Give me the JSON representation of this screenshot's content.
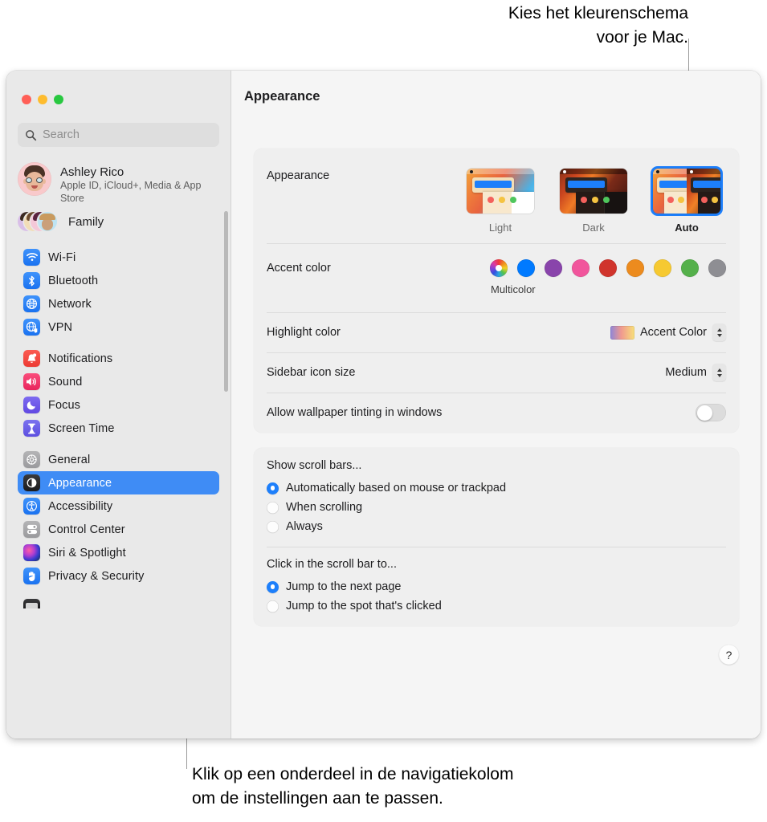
{
  "callouts": {
    "top": "Kies het kleurenschema\nvoor je Mac.",
    "bottom": "Klik op een onderdeel in de navigatiekolom\nom de instellingen aan te passen."
  },
  "window": {
    "traffic_lights": [
      "close",
      "minimize",
      "zoom"
    ]
  },
  "search": {
    "value": "",
    "placeholder": "Search"
  },
  "account": {
    "name": "Ashley Rico",
    "subtitle": "Apple ID, iCloud+, Media & App Store"
  },
  "family": {
    "label": "Family"
  },
  "sidebar": {
    "groups": [
      {
        "items": [
          {
            "label": "Wi-Fi",
            "icon": "wifi-icon",
            "color": "#1a72f0",
            "selected": false
          },
          {
            "label": "Bluetooth",
            "icon": "bluetooth-icon",
            "color": "#1a72f0",
            "selected": false
          },
          {
            "label": "Network",
            "icon": "globe-icon",
            "color": "#1a72f0",
            "selected": false
          },
          {
            "label": "VPN",
            "icon": "vpn-globe-icon",
            "color": "#1a72f0",
            "selected": false
          }
        ]
      },
      {
        "items": [
          {
            "label": "Notifications",
            "icon": "bell-icon",
            "color": "#ec3b33",
            "selected": false
          },
          {
            "label": "Sound",
            "icon": "speaker-icon",
            "color": "#e8245c",
            "selected": false
          },
          {
            "label": "Focus",
            "icon": "moon-icon",
            "color": "#6149e2",
            "selected": false
          },
          {
            "label": "Screen Time",
            "icon": "hourglass-icon",
            "color": "#5d4fe0",
            "selected": false
          }
        ]
      },
      {
        "items": [
          {
            "label": "General",
            "icon": "gear-icon",
            "color": "#9a9a9d",
            "selected": false
          },
          {
            "label": "Appearance",
            "icon": "appearance-icon",
            "color": "#1b1b1d",
            "selected": true
          },
          {
            "label": "Accessibility",
            "icon": "accessibility-icon",
            "color": "#1a72f0",
            "selected": false
          },
          {
            "label": "Control Center",
            "icon": "control-center-icon",
            "color": "#9a9a9d",
            "selected": false
          },
          {
            "label": "Siri & Spotlight",
            "icon": "siri-icon",
            "color": "#b43fd0",
            "selected": false
          },
          {
            "label": "Privacy & Security",
            "icon": "hand-icon",
            "color": "#1a72f0",
            "selected": false
          }
        ]
      }
    ]
  },
  "detail": {
    "title": "Appearance",
    "appearance": {
      "label": "Appearance",
      "options": [
        {
          "label": "Light",
          "selected": false
        },
        {
          "label": "Dark",
          "selected": false
        },
        {
          "label": "Auto",
          "selected": true
        }
      ]
    },
    "accent": {
      "label": "Accent color",
      "caption": "Multicolor",
      "swatches": [
        {
          "name": "multicolor",
          "color": "multicolor",
          "selected": true
        },
        {
          "name": "blue",
          "color": "#007aff",
          "selected": false
        },
        {
          "name": "purple",
          "color": "#8944ab",
          "selected": false
        },
        {
          "name": "pink",
          "color": "#f1559c",
          "selected": false
        },
        {
          "name": "red",
          "color": "#d0342c",
          "selected": false
        },
        {
          "name": "orange",
          "color": "#ec8b1e",
          "selected": false
        },
        {
          "name": "yellow",
          "color": "#f6c931",
          "selected": false
        },
        {
          "name": "green",
          "color": "#54b martes",
          "selected": false
        },
        {
          "name": "graphite",
          "color": "#8e8e93",
          "selected": false
        }
      ]
    },
    "highlight": {
      "label": "Highlight color",
      "value": "Accent Color"
    },
    "sidebar_icon_size": {
      "label": "Sidebar icon size",
      "value": "Medium"
    },
    "wallpaper_tinting": {
      "label": "Allow wallpaper tinting in windows",
      "on": false
    },
    "show_scroll_bars": {
      "title": "Show scroll bars...",
      "options": [
        {
          "label": "Automatically based on mouse or trackpad",
          "selected": true
        },
        {
          "label": "When scrolling",
          "selected": false
        },
        {
          "label": "Always",
          "selected": false
        }
      ]
    },
    "click_scroll_bar": {
      "title": "Click in the scroll bar to...",
      "options": [
        {
          "label": "Jump to the next page",
          "selected": true
        },
        {
          "label": "Jump to the spot that's clicked",
          "selected": false
        }
      ]
    },
    "help": {
      "label": "?"
    }
  }
}
